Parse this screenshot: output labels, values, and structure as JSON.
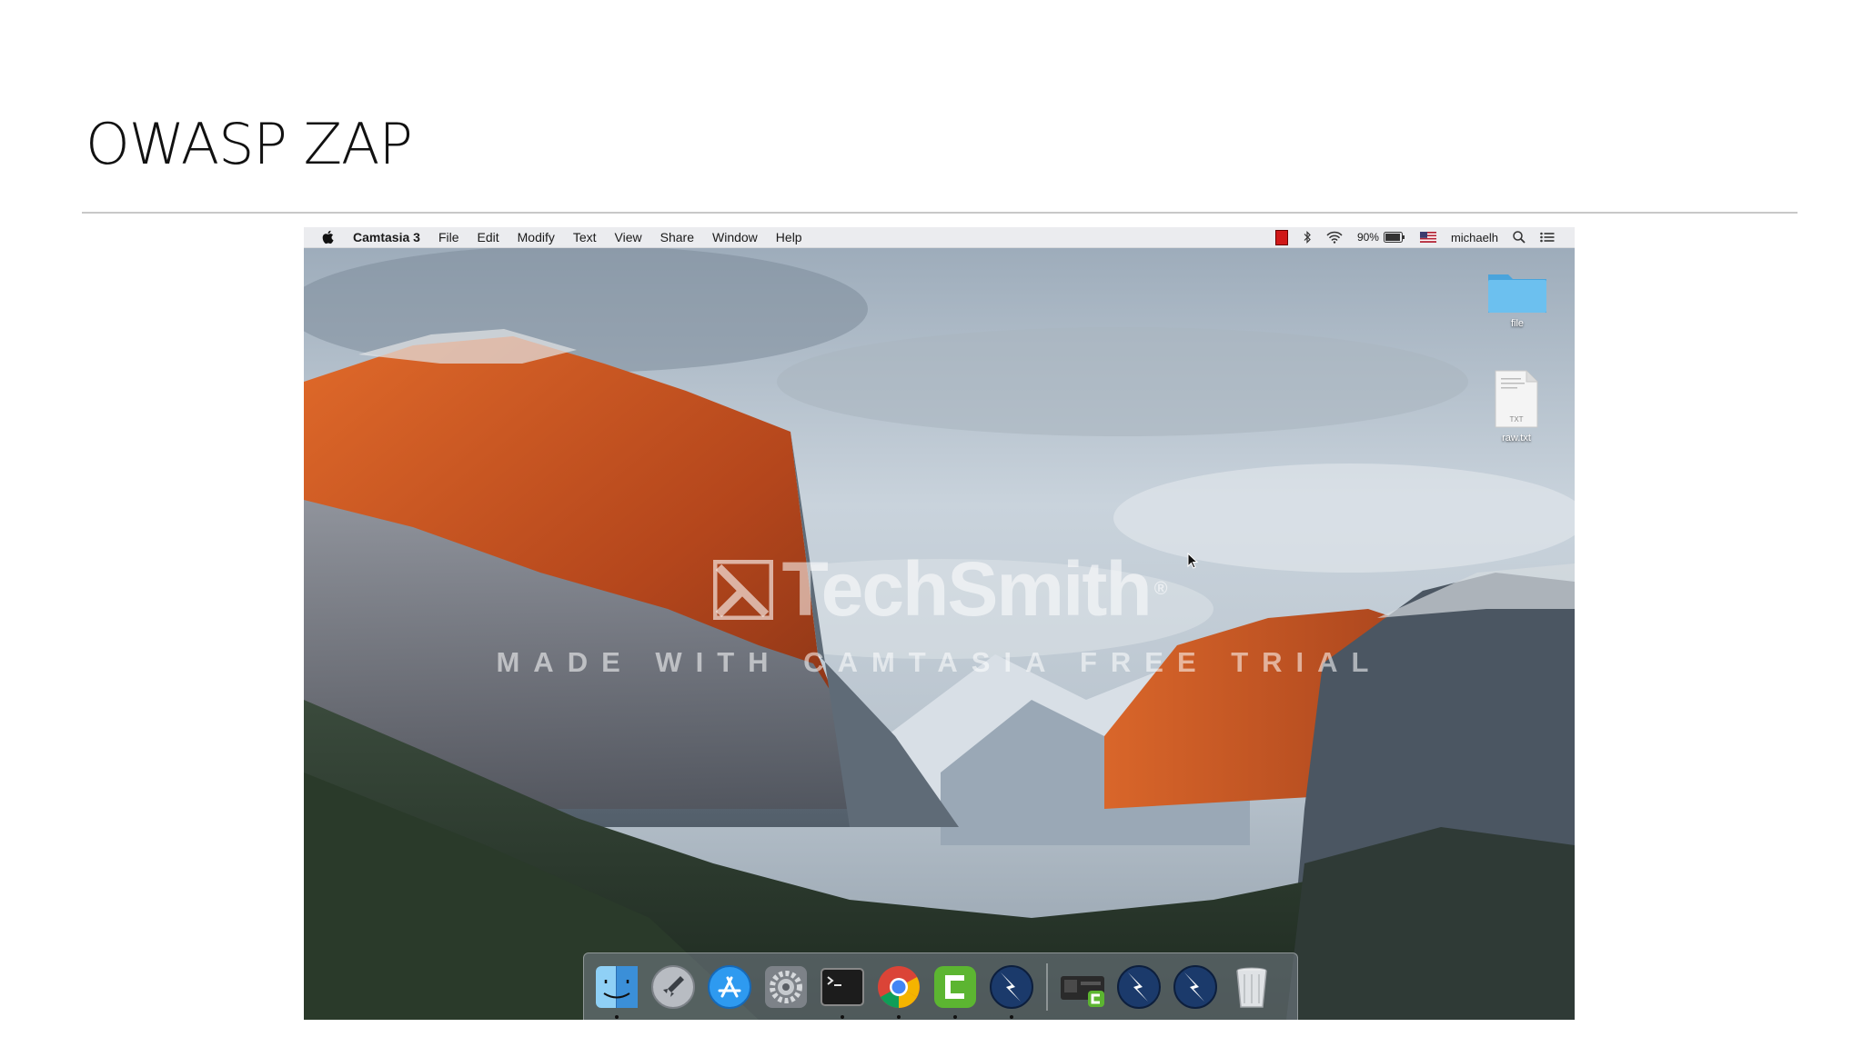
{
  "slide": {
    "title": "OWASP ZAP"
  },
  "menubar": {
    "app_name": "Camtasia 3",
    "menus": [
      "File",
      "Edit",
      "Modify",
      "Text",
      "View",
      "Share",
      "Window",
      "Help"
    ],
    "battery": "90%",
    "user": "michaelh"
  },
  "desktop": {
    "icons": [
      {
        "label": "file",
        "icon": "folder-icon"
      },
      {
        "label": "raw.txt",
        "icon": "text-file-icon",
        "badge": "TXT"
      }
    ]
  },
  "watermark": {
    "brand": "TechSmith",
    "registered": "®",
    "subtitle": "MADE WITH CAMTASIA FREE TRIAL"
  },
  "dock": {
    "items": [
      {
        "name": "finder",
        "icon": "finder-icon",
        "running": true
      },
      {
        "name": "launchpad",
        "icon": "launchpad-rocket-icon",
        "running": false
      },
      {
        "name": "app-store",
        "icon": "app-store-icon",
        "running": false
      },
      {
        "name": "system-preferences",
        "icon": "gear-icon",
        "running": false
      },
      {
        "name": "terminal",
        "icon": "terminal-icon",
        "running": true
      },
      {
        "name": "chrome",
        "icon": "chrome-icon",
        "running": true
      },
      {
        "name": "camtasia",
        "icon": "camtasia-icon",
        "running": true
      },
      {
        "name": "owasp-zap",
        "icon": "zap-lightning-icon",
        "running": true
      },
      {
        "name": "camtasia-recorder",
        "icon": "camtasia-recorder-icon",
        "running": false
      },
      {
        "name": "owasp-zap-2",
        "icon": "zap-lightning-icon",
        "running": false
      },
      {
        "name": "owasp-zap-3",
        "icon": "zap-lightning-icon",
        "running": false
      },
      {
        "name": "trash",
        "icon": "trash-icon",
        "running": false
      }
    ]
  },
  "colors": {
    "rock_orange": "#c8501e",
    "sky": "#c9d3dc",
    "forest": "#2c3a2c",
    "record": "#d01818",
    "folder_blue": "#5ab4e6"
  }
}
